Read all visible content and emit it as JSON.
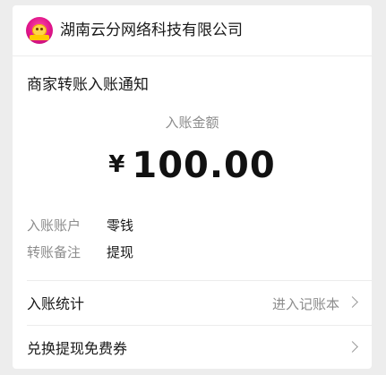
{
  "header": {
    "merchant_name": "湖南云分网络科技有限公司"
  },
  "notice": {
    "title": "商家转账入账通知",
    "amount_label": "入账金额",
    "currency_symbol": "¥",
    "amount": "100.00",
    "details": [
      {
        "label": "入账账户",
        "value": "零钱"
      },
      {
        "label": "转账备注",
        "value": "提现"
      }
    ]
  },
  "links": [
    {
      "label": "入账统计",
      "extra": "进入记账本"
    },
    {
      "label": "兑换提现免费券",
      "extra": ""
    }
  ],
  "colors": {
    "page_bg": "#ededed",
    "card_bg": "#ffffff",
    "muted_text": "#8c8c8c"
  }
}
